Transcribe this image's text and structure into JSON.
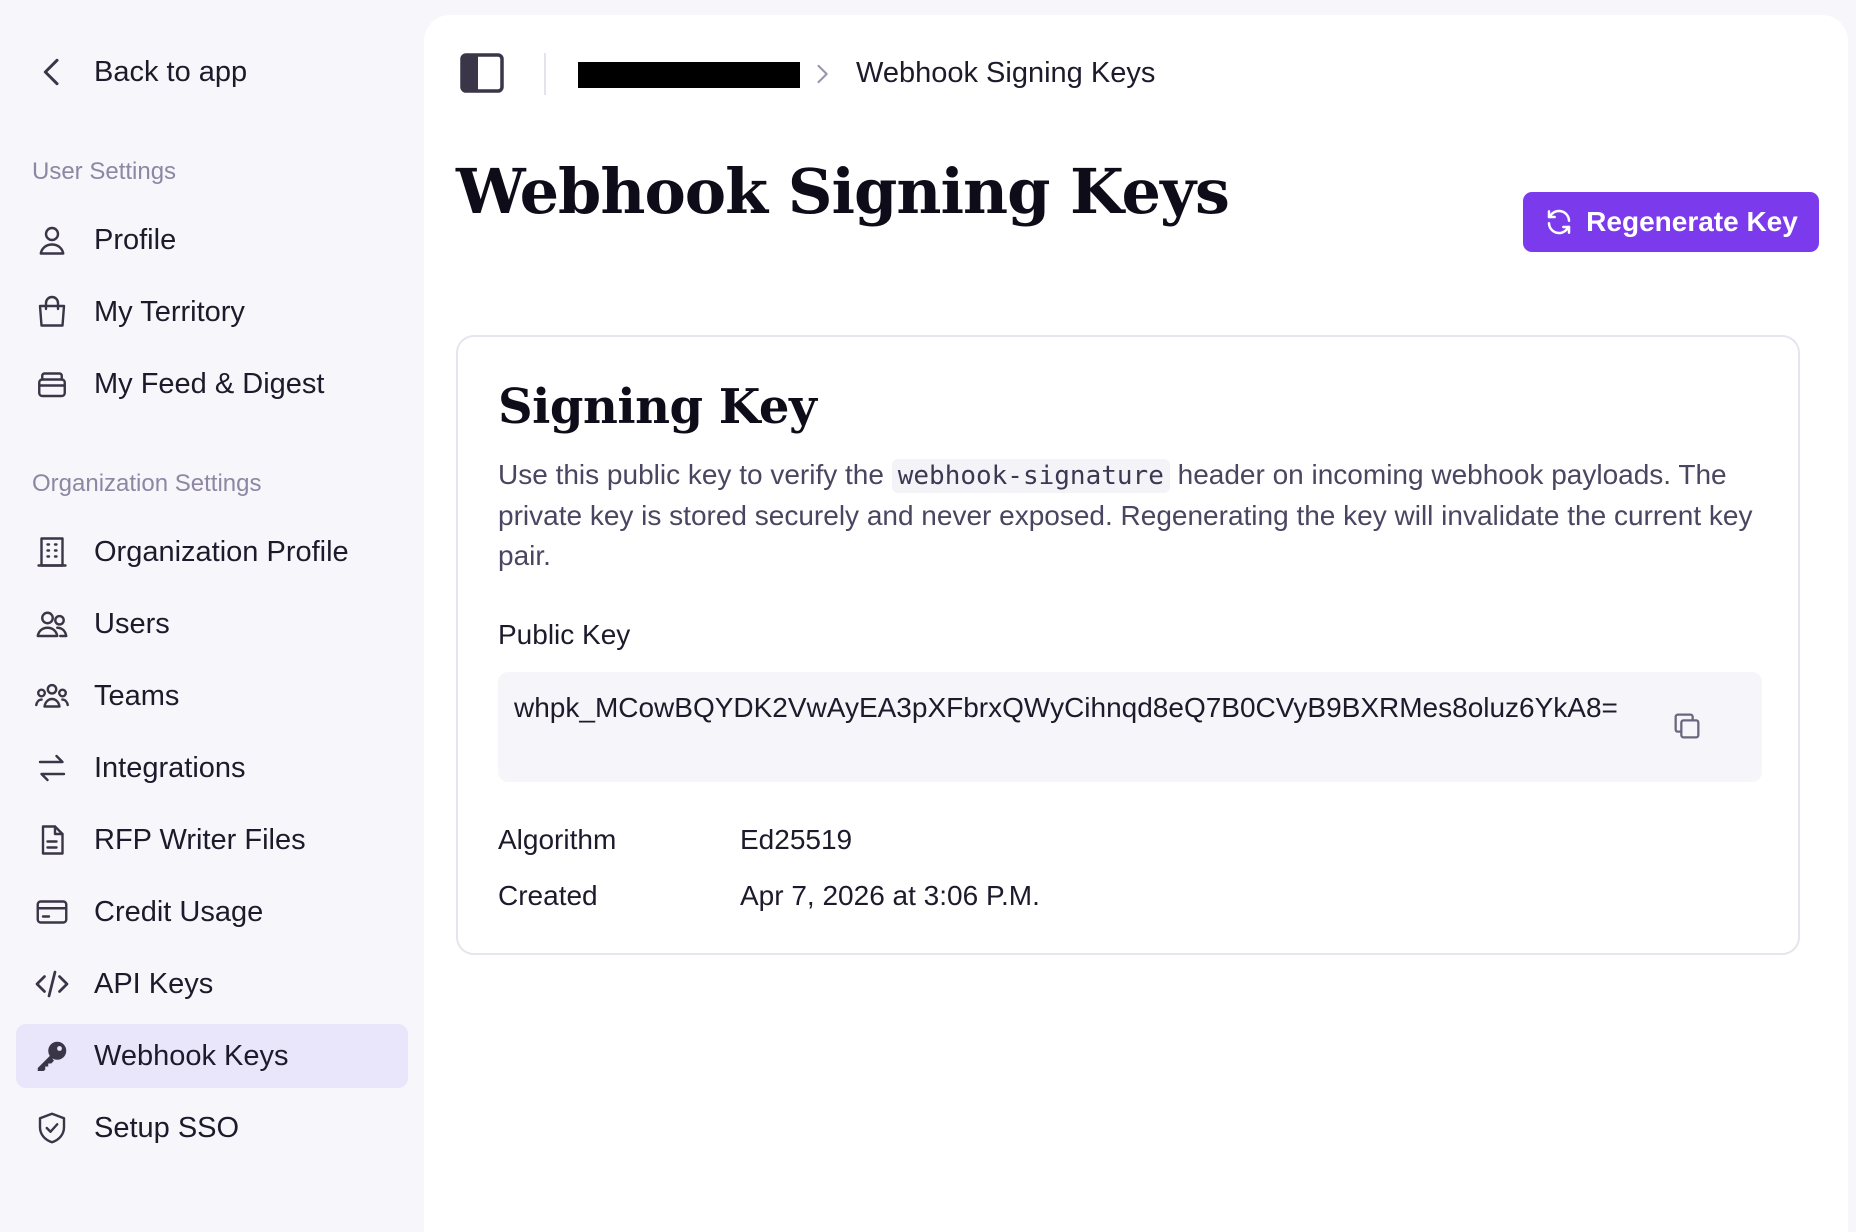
{
  "sidebar": {
    "back_label": "Back to app",
    "user_section_label": "User Settings",
    "org_section_label": "Organization Settings",
    "user_items": [
      {
        "label": "Profile",
        "icon": "user-icon"
      },
      {
        "label": "My Territory",
        "icon": "shopping-bag-icon"
      },
      {
        "label": "My Feed & Digest",
        "icon": "inbox-stack-icon"
      }
    ],
    "org_items": [
      {
        "label": "Organization Profile",
        "icon": "building-icon"
      },
      {
        "label": "Users",
        "icon": "users-icon"
      },
      {
        "label": "Teams",
        "icon": "teams-icon"
      },
      {
        "label": "Integrations",
        "icon": "arrows-exchange-icon"
      },
      {
        "label": "RFP Writer Files",
        "icon": "document-icon"
      },
      {
        "label": "Credit Usage",
        "icon": "credit-card-icon"
      },
      {
        "label": "API Keys",
        "icon": "code-icon"
      },
      {
        "label": "Webhook Keys",
        "icon": "key-icon",
        "active": true
      },
      {
        "label": "Setup SSO",
        "icon": "shield-check-icon"
      }
    ]
  },
  "breadcrumb": {
    "current": "Webhook Signing Keys"
  },
  "page": {
    "title": "Webhook Signing Keys",
    "regenerate_label": "Regenerate Key"
  },
  "card": {
    "title": "Signing Key",
    "desc_before": "Use this public key to verify the ",
    "desc_code": "webhook-signature",
    "desc_after": " header on incoming webhook payloads. The private key is stored securely and never exposed. Regenerating the key will invalidate the current key pair.",
    "public_key_label": "Public Key",
    "public_key_value": "whpk_MCowBQYDK2VwAyEA3pXFbrxQWyCihnqd8eQ7B0CVyB9BXRMes8oluz6YkA8=",
    "algorithm_label": "Algorithm",
    "algorithm_value": "Ed25519",
    "created_label": "Created",
    "created_value": "Apr 7, 2026 at 3:06 P.M."
  },
  "colors": {
    "accent": "#7c3aed",
    "active_nav_bg": "#e9e6fb",
    "sidebar_bg": "#f7f6fa"
  }
}
